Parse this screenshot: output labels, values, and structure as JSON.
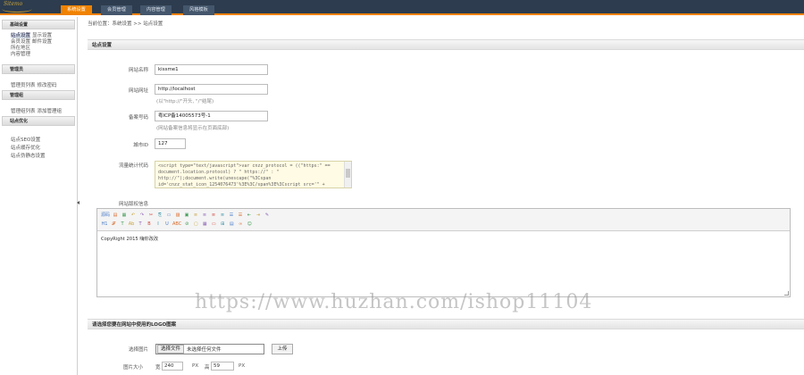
{
  "header": {
    "logo_text": "Sitemo",
    "tabs": [
      {
        "label": "系统设置"
      },
      {
        "label": "会员管理"
      },
      {
        "label": "内容管理"
      },
      {
        "label": "风格模板"
      }
    ]
  },
  "sidebar": {
    "groups": [
      {
        "title": "基础设置",
        "lines": [
          [
            "站点设置",
            "显示设置"
          ],
          [
            "会员设置",
            "邮件设置"
          ],
          [
            "所在地区"
          ],
          [
            "内容管理"
          ]
        ]
      },
      {
        "title": "管理员",
        "lines": [
          [
            "管理员列表",
            "修改密码"
          ]
        ]
      },
      {
        "title": "管理组",
        "lines": [
          [
            "管理组列表",
            "添加管理组"
          ]
        ]
      },
      {
        "title": "站点优化",
        "lines": [
          [
            "站点SEO设置"
          ],
          [
            "站点缓存优化"
          ],
          [
            "站点伪静态设置"
          ]
        ]
      }
    ]
  },
  "breadcrumb": "当前位置：系统设置 >> 站点设置",
  "site_section": {
    "title": "站点设置",
    "site_name_label": "网站名称",
    "site_name_value": "kissme1",
    "site_url_label": "网站网址",
    "site_url_value": "http://localhost",
    "site_url_hint": "(以\"http://\"开头, \"/\"结尾)",
    "icp_label": "备案号码",
    "icp_value": "粤ICP备14005573号-1",
    "icp_hint": "(网站备案信息将显示在页面底部)",
    "city_label": "城市ID",
    "city_value": "127",
    "stats_label": "流量统计代码",
    "stats_code": "<script type=\"text/javascript\">var cnzz_protocol = ((\"https:\" == document.location.protocol) ? \" https://\" : \" http://\");document.write(unescape(\"%3Cspan id='cnzz_stat_icon_1254076473'%3E%3C/span%3E%3Cscript src='\" +",
    "copyright_label": "网站版权信息",
    "toolbar_row1": [
      "源码",
      "▤",
      "▦",
      "↶",
      "↷",
      "✂",
      "⎘",
      "▭",
      "▨",
      "▣",
      "≡",
      "≡",
      "≡",
      "≡",
      "☰",
      "☰",
      "⇤",
      "⇥",
      "✎"
    ],
    "toolbar_row2": [
      "H1",
      "𝓕",
      "T",
      "Ab",
      "T",
      "B",
      "I",
      "U",
      "ABC",
      "⊘",
      "▢",
      "▦",
      "▭",
      "⊞",
      "▤",
      "∞",
      "☺"
    ],
    "copyright_text": "CopyRight 2015  嗨你改改"
  },
  "watermark": "https://www.huzhan.com/ishop11104",
  "logo_section": {
    "title": "请选择您要在网站中使用的LOGO图案",
    "choose_label": "选择图片",
    "file_button": "选择文件",
    "file_status": "未选择任何文件",
    "upload_button": "上传",
    "size_label": "图片大小",
    "width_prefix": "宽",
    "width_value": "240",
    "px_label": "PX",
    "height_prefix": "高",
    "height_value": "59"
  },
  "colors": {
    "topbar": "#2d3c4e",
    "accent": "#f08200",
    "code_bg": "#fffbe4"
  }
}
